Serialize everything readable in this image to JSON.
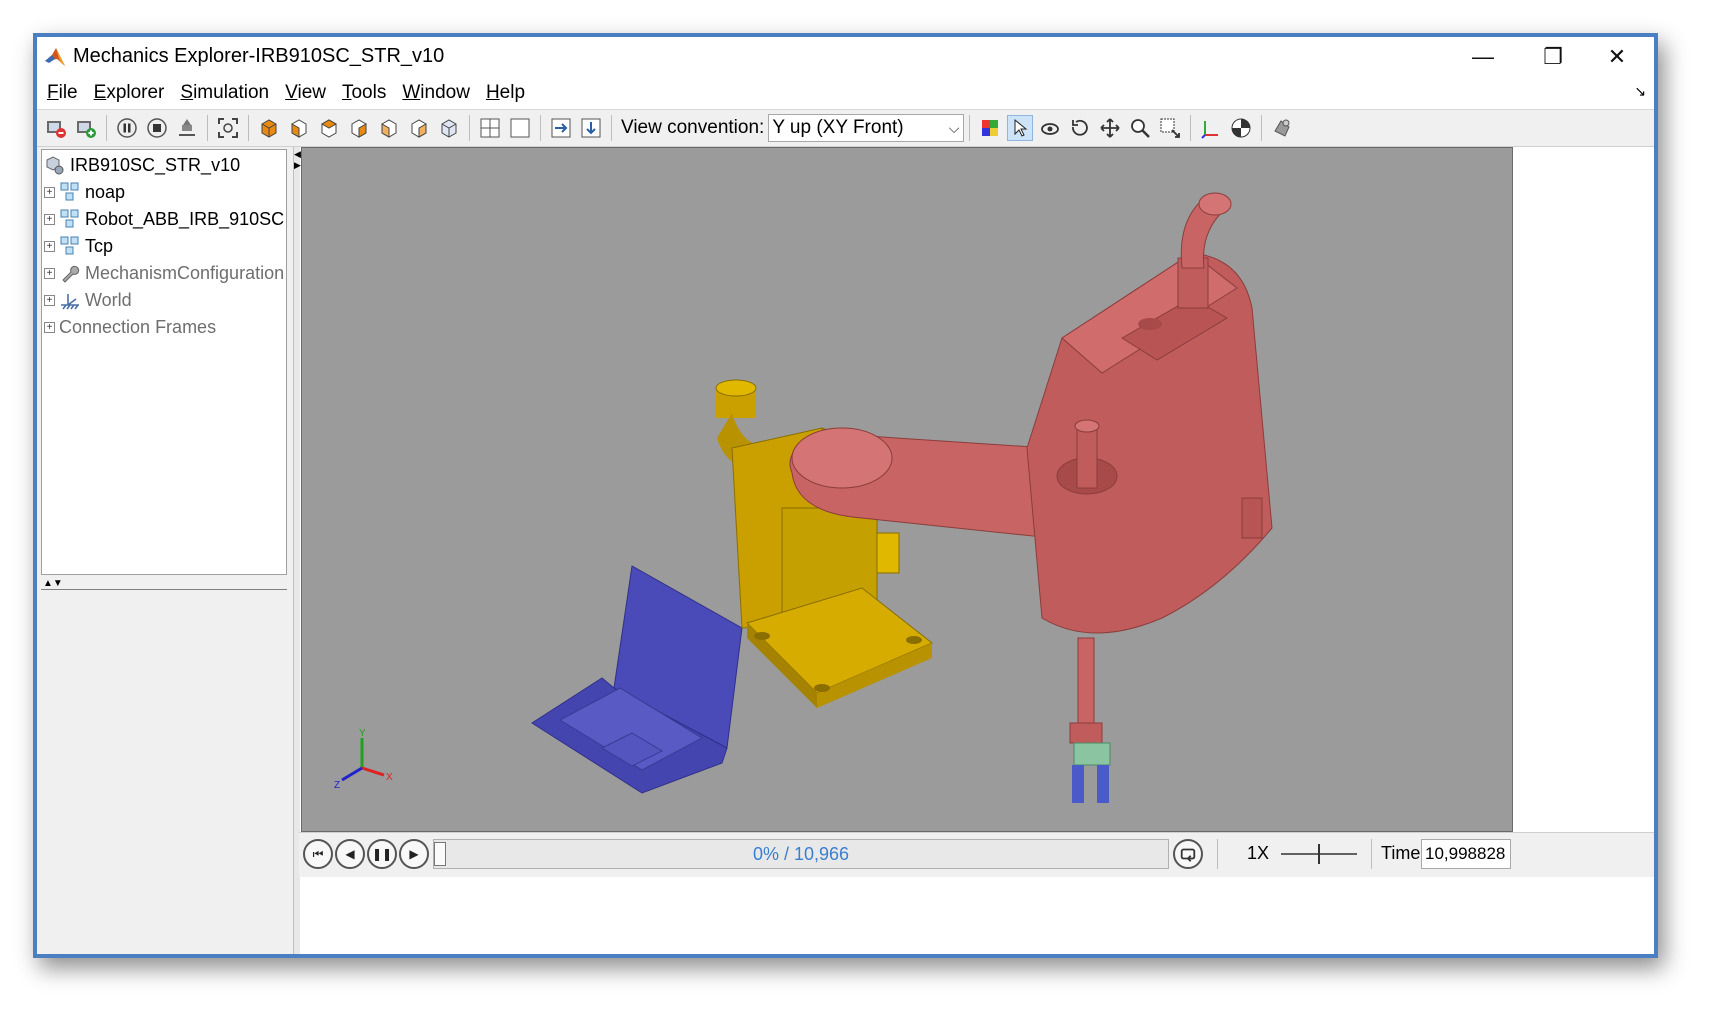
{
  "window": {
    "title": "Mechanics Explorer-IRB910SC_STR_v10",
    "minimize_glyph": "—",
    "maximize_glyph": "❐",
    "close_glyph": "✕"
  },
  "menu": {
    "items": [
      "File",
      "Explorer",
      "Simulation",
      "View",
      "Tools",
      "Window",
      "Help"
    ]
  },
  "toolbar": {
    "view_convention_label": "View convention:",
    "view_convention_value": "Y up (XY Front)",
    "icons": [
      "reset-camera-icon",
      "save-view-icon",
      "pause-icon",
      "stop-icon",
      "ground-icon",
      "fit-to-view-icon",
      "iso-view-icon",
      "front-view-icon",
      "back-view-icon",
      "left-view-icon",
      "right-view-icon",
      "top-view-icon",
      "bottom-view-icon",
      "single-tile-icon",
      "four-tile-icon",
      "split-horizontal-icon",
      "split-vertical-icon",
      "color-icon",
      "select-icon",
      "rotate-icon",
      "roll-icon",
      "pan-icon",
      "zoom-icon",
      "box-zoom-icon",
      "frames-icon",
      "center-of-mass-icon",
      "convex-hull-icon"
    ]
  },
  "tree": {
    "root": "IRB910SC_STR_v10",
    "items": [
      {
        "label": "noap",
        "dim": false
      },
      {
        "label": "Robot_ABB_IRB_910SC",
        "dim": false
      },
      {
        "label": "Tcp",
        "dim": false
      },
      {
        "label": "MechanismConfiguration",
        "dim": true
      },
      {
        "label": "World",
        "dim": true
      },
      {
        "label": "Connection Frames",
        "dim": true
      }
    ]
  },
  "viewport": {
    "background": "#9b9b9b",
    "robot_color": "#c86464",
    "base_color": "#c9a000",
    "laptop_color": "#4a4ab8",
    "axis_labels": {
      "x": "X",
      "y": "Y",
      "z": "Z"
    }
  },
  "playback": {
    "progress_text": "0% / 10,966",
    "progress_fraction": 0.0,
    "speed": "1X",
    "time_label": "Time",
    "time_value": "10,998828"
  }
}
